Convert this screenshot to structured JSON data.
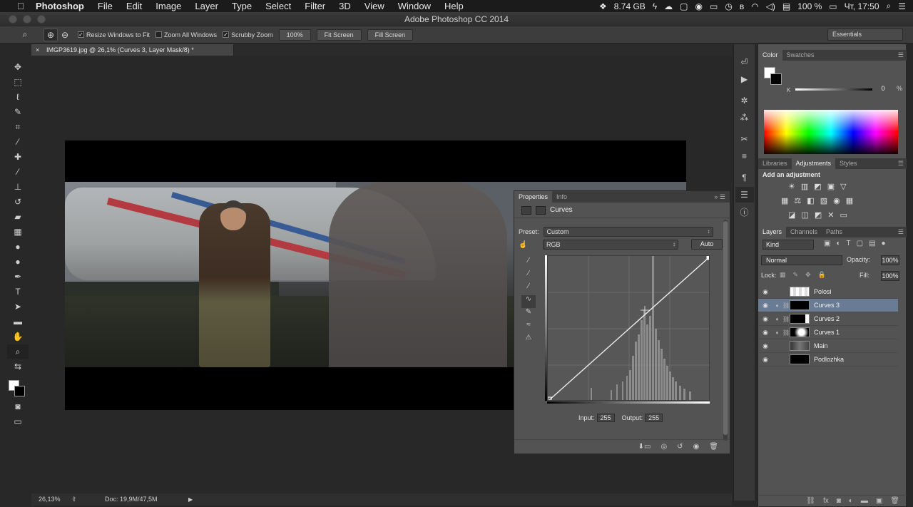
{
  "menubar": {
    "apple": "",
    "items": [
      "Photoshop",
      "File",
      "Edit",
      "Image",
      "Layer",
      "Type",
      "Select",
      "Filter",
      "3D",
      "View",
      "Window",
      "Help"
    ],
    "memory": "8.74 GB",
    "battery": "100 %",
    "clock": "Чт, 17:50"
  },
  "window": {
    "title": "Adobe Photoshop CC 2014"
  },
  "options": {
    "resize_windows": "Resize Windows to Fit",
    "zoom_all": "Zoom All Windows",
    "scrubby": "Scrubby Zoom",
    "zoom_pct": "100%",
    "fit_screen": "Fit Screen",
    "fill_screen": "Fill Screen",
    "workspace": "Essentials"
  },
  "document": {
    "tab_title": "IMGP3619.jpg @ 26,1% (Curves 3, Layer Mask/8) *",
    "close": "×"
  },
  "statusbar": {
    "zoom": "26,13%",
    "doc": "Doc: 19,9M/47,5M"
  },
  "properties": {
    "tabs": [
      "Properties",
      "Info"
    ],
    "title": "Curves",
    "preset_label": "Preset:",
    "preset_value": "Custom",
    "channel": "RGB",
    "auto": "Auto",
    "input_label": "Input:",
    "input_value": "255",
    "output_label": "Output:",
    "output_value": "255"
  },
  "color": {
    "tabs": [
      "Color",
      "Swatches"
    ],
    "k_label": "K",
    "k_value": "0",
    "k_unit": "%"
  },
  "adjustments": {
    "tabs": [
      "Libraries",
      "Adjustments",
      "Styles"
    ],
    "title": "Add an adjustment",
    "row1": [
      "☀",
      "▥",
      "◩",
      "▣",
      "▽"
    ],
    "row2": [
      "▦",
      "⚖",
      "◧",
      "▨",
      "◉",
      "▦"
    ],
    "row3": [
      "◪",
      "◫",
      "◩",
      "✕",
      "▭"
    ]
  },
  "layers": {
    "tabs": [
      "Layers",
      "Channels",
      "Paths"
    ],
    "filter": "Kind",
    "blend": "Normal",
    "opacity_label": "Opacity:",
    "opacity_value": "100%",
    "lock_label": "Lock:",
    "fill_label": "Fill:",
    "fill_value": "100%",
    "items": [
      {
        "name": "Polosi",
        "selected": false
      },
      {
        "name": "Curves 3",
        "selected": true
      },
      {
        "name": "Curves 2",
        "selected": false
      },
      {
        "name": "Curves 1",
        "selected": false
      },
      {
        "name": "Main",
        "selected": false
      },
      {
        "name": "Podlozhka",
        "selected": false
      }
    ]
  },
  "colors": {
    "selection": "#6a7c93",
    "panel_bg": "#535353",
    "app_bg": "#282828"
  }
}
